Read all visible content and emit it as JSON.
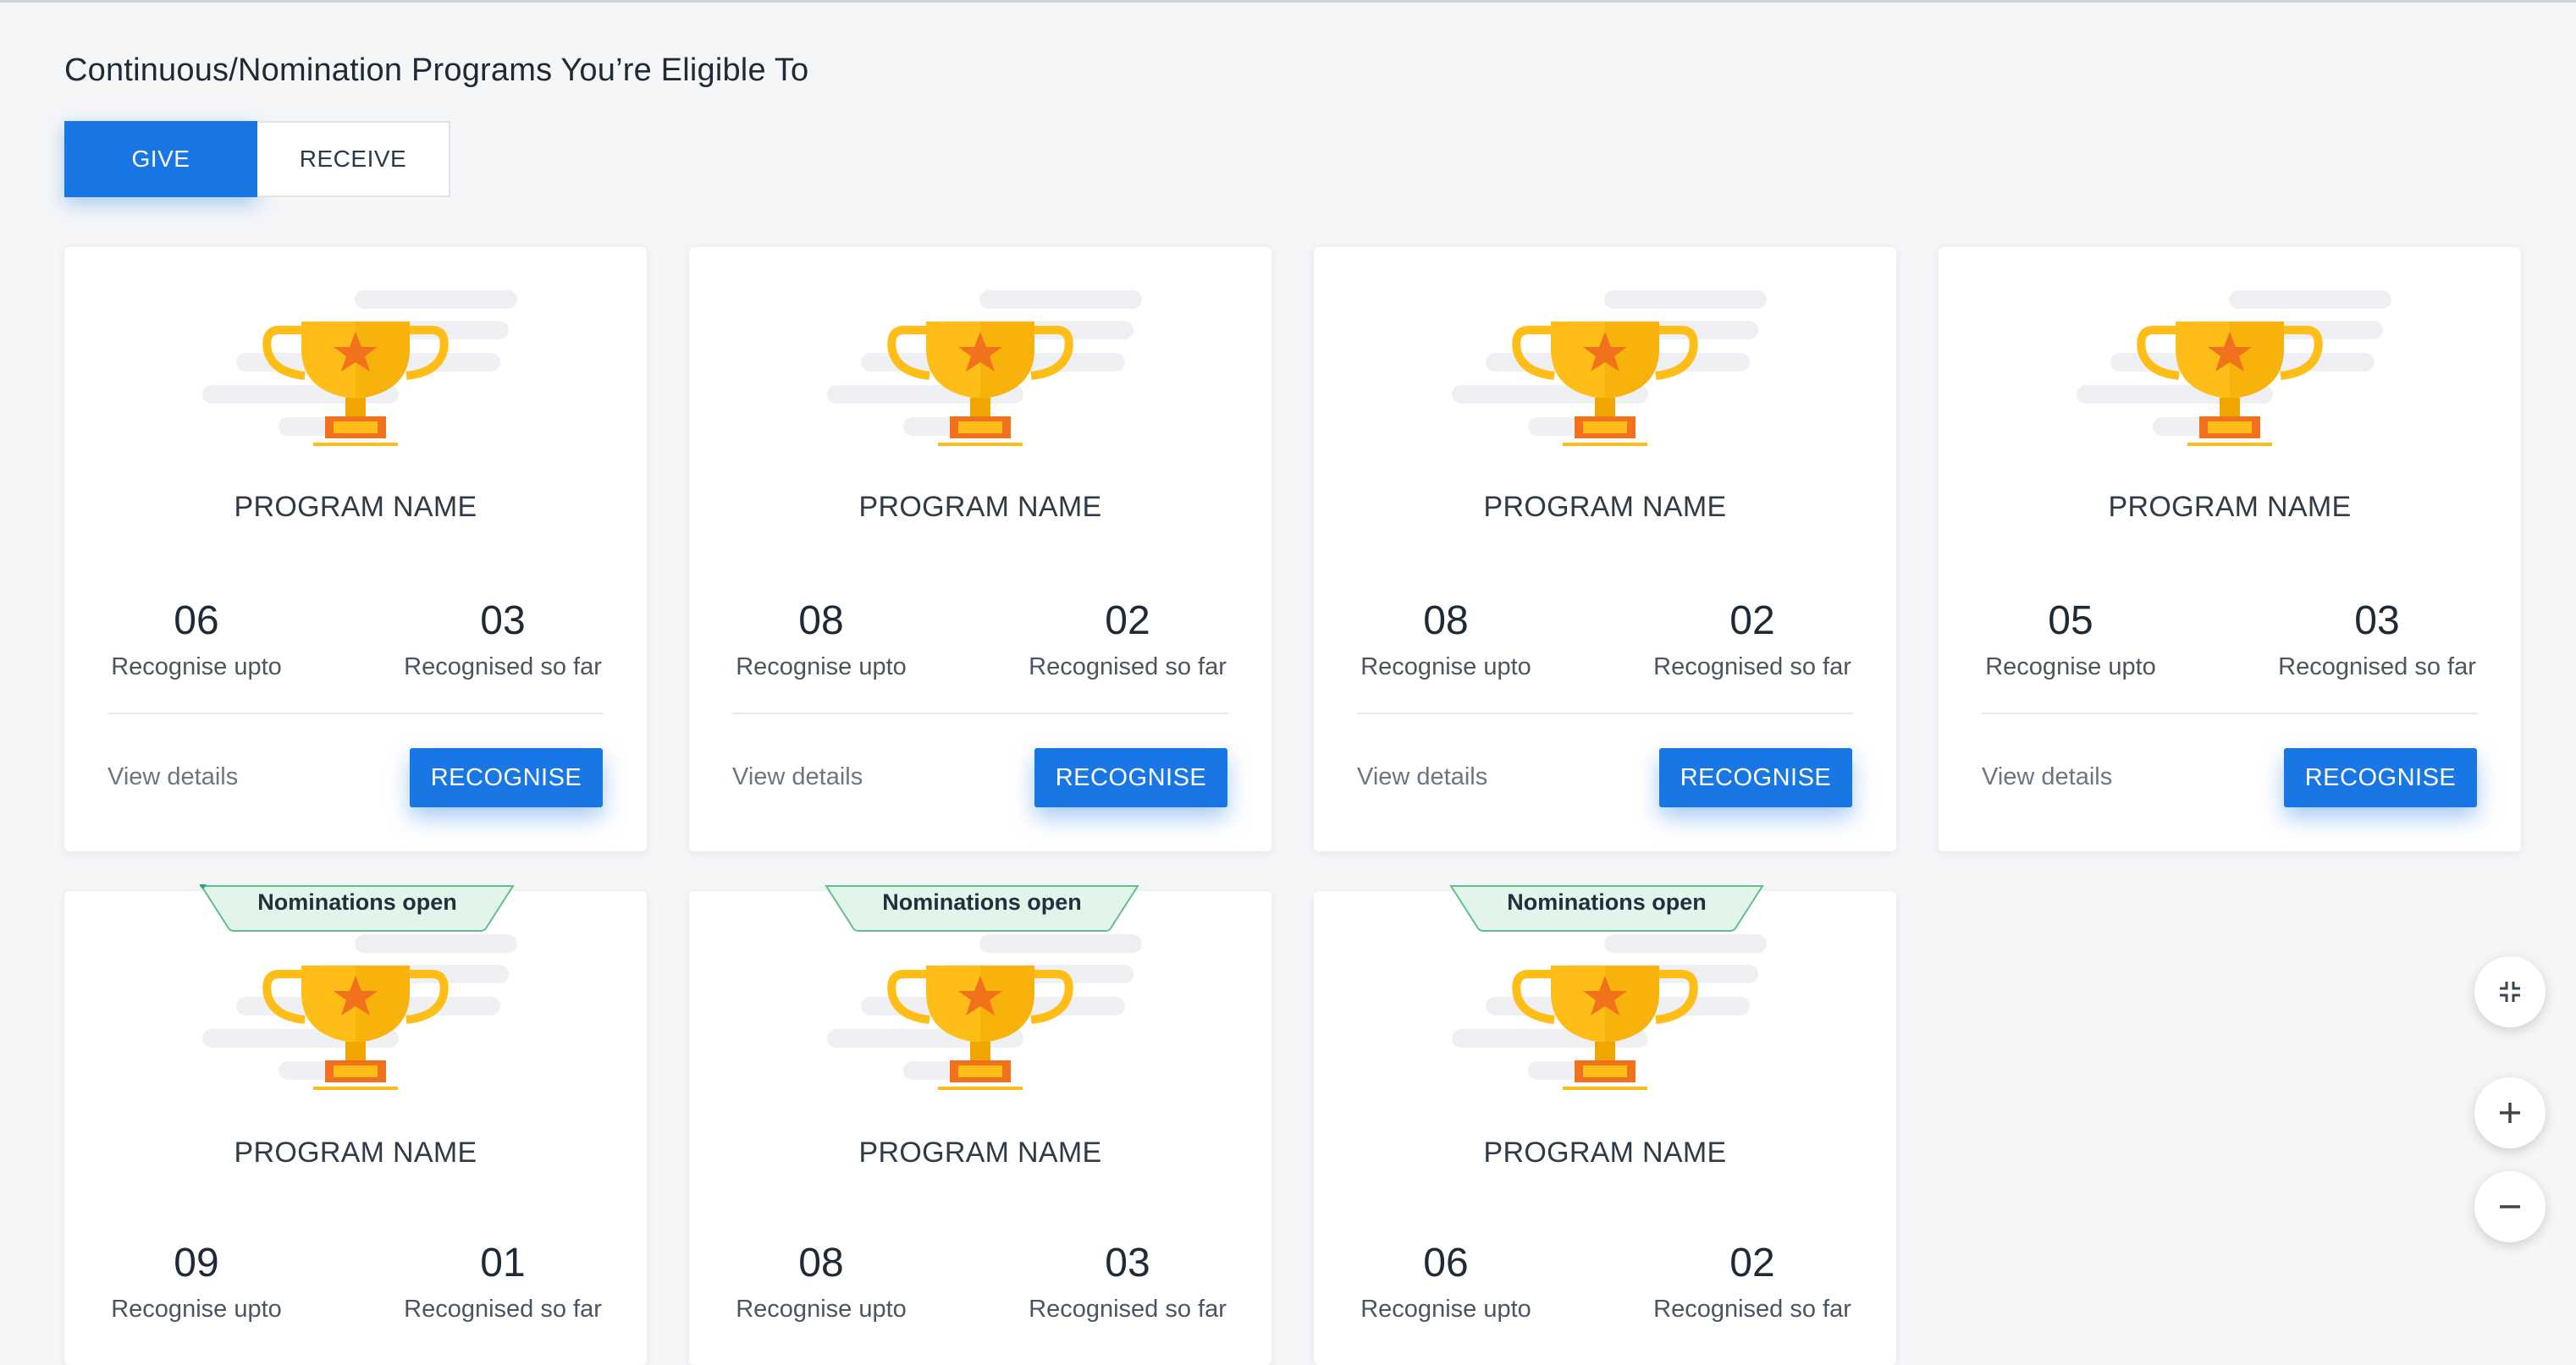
{
  "page": {
    "title": "Continuous/Nomination Programs You’re Eligible To"
  },
  "toggle": {
    "give_label": "GIVE",
    "receive_label": "RECEIVE",
    "active": "GIVE"
  },
  "colors": {
    "accent": "#1877e5",
    "background": "#f5f6f8",
    "banner_fill": "#e3f5ea",
    "banner_border": "#5fc08a",
    "trophy_gold": "#ffbd17",
    "trophy_orange": "#f2711c"
  },
  "programs": [
    {
      "name": "PROGRAM NAME",
      "upto": "06",
      "upto_label": "Recognise upto",
      "sofar": "03",
      "sofar_label": "Recognised so far",
      "view_label": "View details",
      "button_label": "RECOGNISE"
    },
    {
      "name": "PROGRAM NAME",
      "upto": "08",
      "upto_label": "Recognise upto",
      "sofar": "02",
      "sofar_label": "Recognised so far",
      "view_label": "View details",
      "button_label": "RECOGNISE"
    },
    {
      "name": "PROGRAM NAME",
      "upto": "08",
      "upto_label": "Recognise upto",
      "sofar": "02",
      "sofar_label": "Recognised so far",
      "view_label": "View details",
      "button_label": "RECOGNISE"
    },
    {
      "name": "PROGRAM NAME",
      "upto": "05",
      "upto_label": "Recognise upto",
      "sofar": "03",
      "sofar_label": "Recognised so far",
      "view_label": "View details",
      "button_label": "RECOGNISE"
    },
    {
      "banner": "Nominations open",
      "name": "PROGRAM NAME",
      "upto": "09",
      "upto_label": "Recognise upto",
      "sofar": "01",
      "sofar_label": "Recognised so far"
    },
    {
      "banner": "Nominations open",
      "name": "PROGRAM NAME",
      "upto": "08",
      "upto_label": "Recognise upto",
      "sofar": "03",
      "sofar_label": "Recognised so far"
    },
    {
      "banner": "Nominations open",
      "name": "PROGRAM NAME",
      "upto": "06",
      "upto_label": "Recognise upto",
      "sofar": "02",
      "sofar_label": "Recognised so far"
    }
  ],
  "controls": {
    "shrink_icon": "shrink-icon",
    "zoom_in_icon": "plus-icon",
    "zoom_out_icon": "minus-icon"
  }
}
